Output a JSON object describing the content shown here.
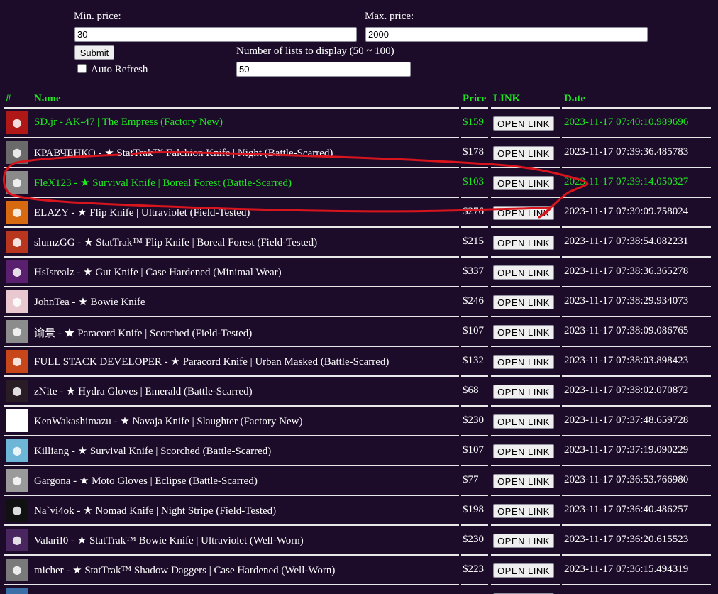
{
  "filters": {
    "min_price_label": "Min. price:",
    "min_price_value": "30",
    "max_price_label": "Max. price:",
    "max_price_value": "2000",
    "submit_label": "Submit",
    "auto_refresh_label": "Auto Refresh",
    "lists_label": "Number of lists to display (50 ~ 100)",
    "lists_value": "50"
  },
  "table": {
    "headers": {
      "num": "#",
      "name": "Name",
      "price": "Price",
      "link": "LINK",
      "date": "Date"
    },
    "open_link_label": "OPEN LINK",
    "rows": [
      {
        "name": "SD.jr - AK-47 | The Empress (Factory New)",
        "price": "$159",
        "date": "2023-11-17 07:40:10.989696",
        "highlight": true,
        "avatar_color": "#b01818",
        "avatar_icon": "bird-avatar"
      },
      {
        "name": "КРАВЧЕНКО - ★ StatTrak™ Falchion Knife | Night (Battle-Scarred)",
        "price": "$178",
        "date": "2023-11-17 07:39:36.485783",
        "highlight": false,
        "avatar_color": "#6a6a6a",
        "avatar_icon": "grey-figure-avatar"
      },
      {
        "name": "FleX123 - ★ Survival Knife | Boreal Forest (Battle-Scarred)",
        "price": "$103",
        "date": "2023-11-17 07:39:14.050327",
        "highlight": true,
        "avatar_color": "#8a8a8a",
        "avatar_icon": "portrait-avatar"
      },
      {
        "name": "ELAZY - ★ Flip Knife | Ultraviolet (Field-Tested)",
        "price": "$276",
        "date": "2023-11-17 07:39:09.758024",
        "highlight": false,
        "avatar_color": "#d76a10",
        "avatar_icon": "orange-face-avatar"
      },
      {
        "name": "slumzGG - ★ StatTrak™ Flip Knife | Boreal Forest (Field-Tested)",
        "price": "$215",
        "date": "2023-11-17 07:38:54.082231",
        "highlight": false,
        "avatar_color": "#b8361e",
        "avatar_icon": "character-avatar"
      },
      {
        "name": "HsIsrealz - ★ Gut Knife | Case Hardened (Minimal Wear)",
        "price": "$337",
        "date": "2023-11-17 07:38:36.365278",
        "highlight": false,
        "avatar_color": "#5a1f6e",
        "avatar_icon": "purple-avatar"
      },
      {
        "name": "JohnTea - ★ Bowie Knife",
        "price": "$246",
        "date": "2023-11-17 07:38:29.934073",
        "highlight": false,
        "avatar_color": "#e9c9cf",
        "avatar_icon": "anime-avatar"
      },
      {
        "name": "谕景 - ★ Paracord Knife | Scorched (Field-Tested)",
        "price": "$107",
        "date": "2023-11-17 07:38:09.086765",
        "highlight": false,
        "avatar_color": "#8c8c8c",
        "avatar_icon": "cat-avatar"
      },
      {
        "name": "FULL STACK DEVELOPER - ★ Paracord Knife | Urban Masked (Battle-Scarred)",
        "price": "$132",
        "date": "2023-11-17 07:38:03.898423",
        "highlight": false,
        "avatar_color": "#c8471a",
        "avatar_icon": "fire-avatar"
      },
      {
        "name": "zNite - ★ Hydra Gloves | Emerald (Battle-Scarred)",
        "price": "$68",
        "date": "2023-11-17 07:38:02.070872",
        "highlight": false,
        "avatar_color": "#2a1c24",
        "avatar_icon": "dark-logo-avatar"
      },
      {
        "name": "KenWakashimazu - ★ Navaja Knife | Slaughter (Factory New)",
        "price": "$230",
        "date": "2023-11-17 07:37:48.659728",
        "highlight": false,
        "avatar_color": "#ffffff",
        "avatar_icon": "100-logo-avatar"
      },
      {
        "name": "Killiang - ★ Survival Knife | Scorched (Battle-Scarred)",
        "price": "$107",
        "date": "2023-11-17 07:37:19.090229",
        "highlight": false,
        "avatar_color": "#6eb6d8",
        "avatar_icon": "cartoon-avatar"
      },
      {
        "name": "Gargona - ★ Moto Gloves | Eclipse (Battle-Scarred)",
        "price": "$77",
        "date": "2023-11-17 07:36:53.766980",
        "highlight": false,
        "avatar_color": "#9a9a9a",
        "avatar_icon": "sketch-avatar"
      },
      {
        "name": "Na`vi4ok - ★ Nomad Knife | Night Stripe (Field-Tested)",
        "price": "$198",
        "date": "2023-11-17 07:36:40.486257",
        "highlight": false,
        "avatar_color": "#111111",
        "avatar_icon": "navi-logo-avatar"
      },
      {
        "name": "ValariI0 - ★ StatTrak™ Bowie Knife | Ultraviolet (Well-Worn)",
        "price": "$230",
        "date": "2023-11-17 07:36:20.615523",
        "highlight": false,
        "avatar_color": "#4a2660",
        "avatar_icon": "anime-girl-avatar"
      },
      {
        "name": "micher - ★ StatTrak™ Shadow Daggers | Case Hardened (Well-Worn)",
        "price": "$223",
        "date": "2023-11-17 07:36:15.494319",
        "highlight": false,
        "avatar_color": "#7a7a7a",
        "avatar_icon": "dark-portrait-avatar"
      },
      {
        "name": "",
        "price": "",
        "date": "",
        "highlight": false,
        "avatar_color": "#3b6fa8",
        "avatar_icon": "blue-avatar"
      }
    ]
  },
  "colors": {
    "background": "#1c0c2a",
    "highlight_text": "#1ee81e",
    "separator": "#e8e8e8",
    "annotation_stroke": "#d8141c"
  }
}
